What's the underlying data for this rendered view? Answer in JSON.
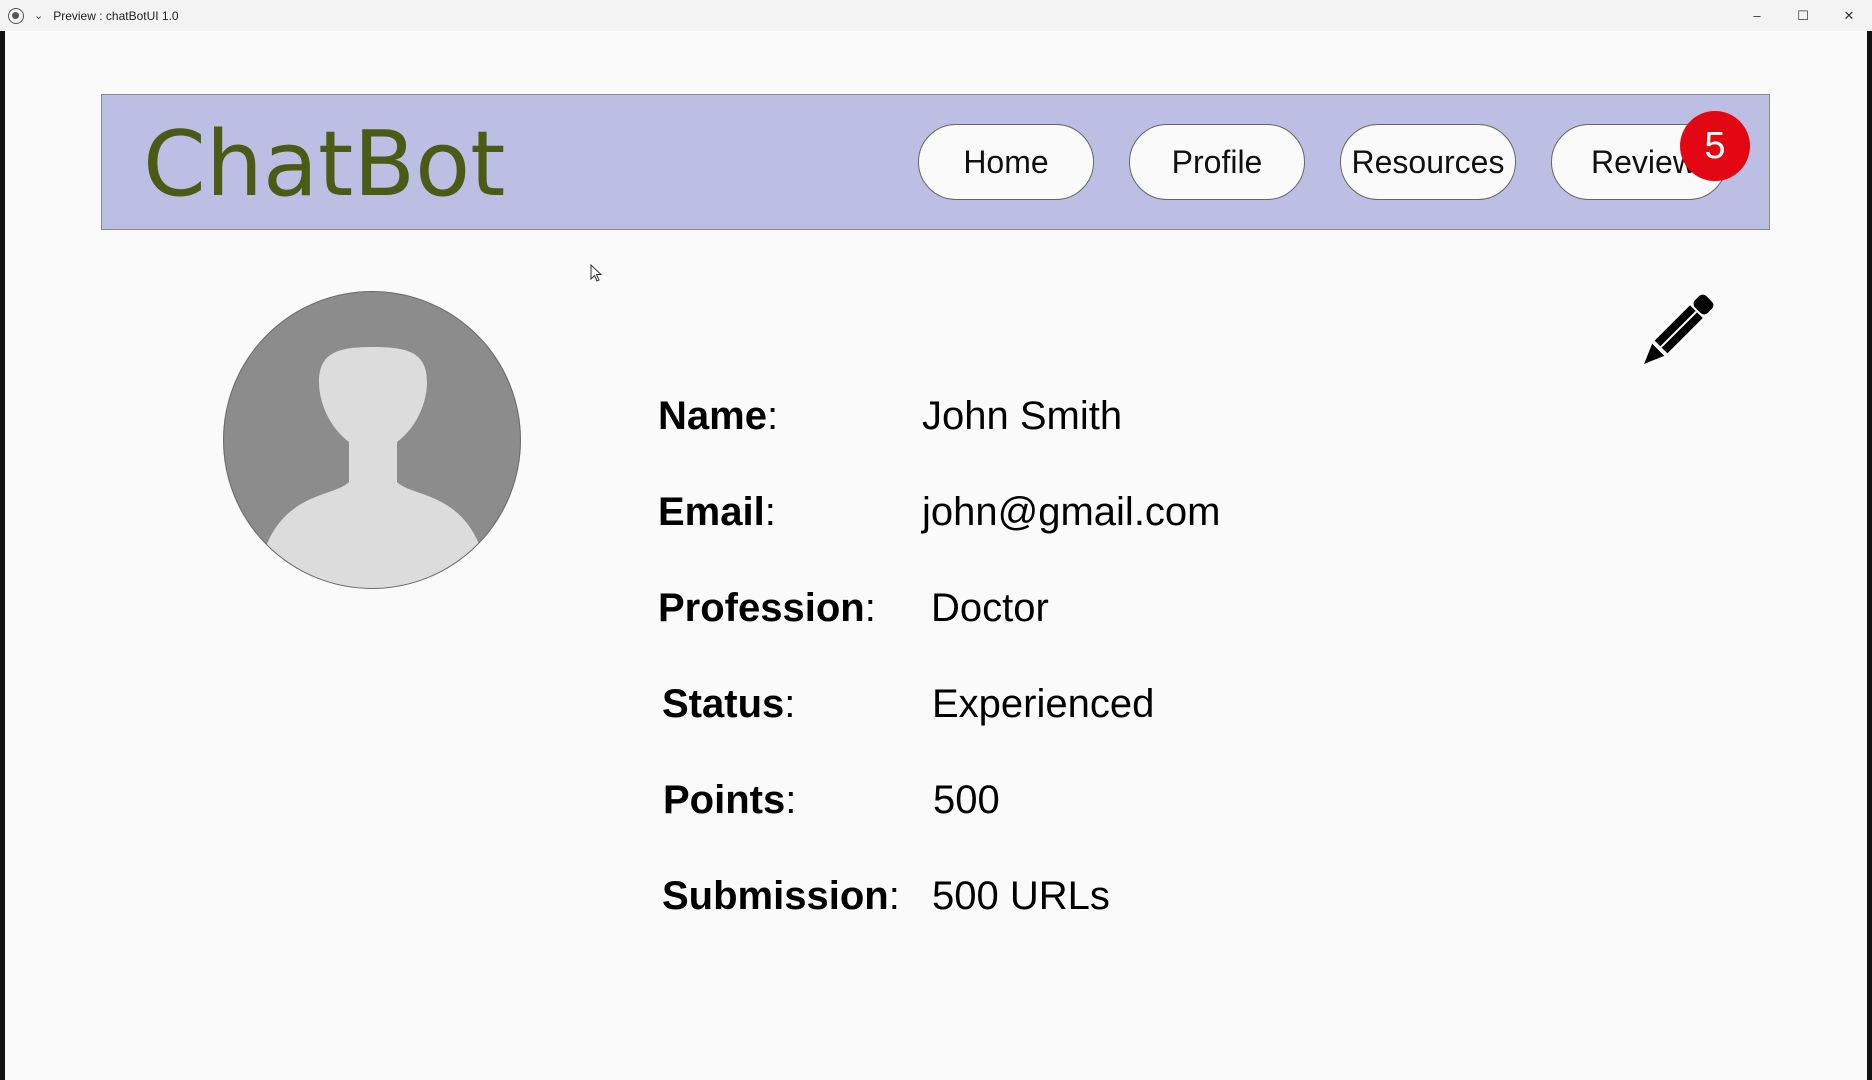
{
  "window": {
    "title": "Preview : chatBotUI 1.0",
    "chevron": "⌄",
    "minimize": "–",
    "maximize": "☐",
    "close": "✕"
  },
  "header": {
    "brand": "ChatBot",
    "nav": {
      "home": "Home",
      "profile": "Profile",
      "resources": "Resources",
      "review": "Review"
    },
    "review_badge": "5",
    "background": "#bcbfe3",
    "brand_color": "#4b5a14",
    "badge_color": "#e30613"
  },
  "profile": {
    "avatar": "user-placeholder-icon",
    "edit": "pencil-icon",
    "colon": ":",
    "fields": {
      "name": {
        "label": "Name",
        "value": "John Smith"
      },
      "email": {
        "label": "Email",
        "value": "john@gmail.com"
      },
      "profession": {
        "label": "Profession",
        "value": "Doctor"
      },
      "status": {
        "label": "Status",
        "value": "Experienced"
      },
      "points": {
        "label": "Points",
        "value": "500"
      },
      "submission": {
        "label": "Submission",
        "value": "500 URLs"
      }
    }
  }
}
